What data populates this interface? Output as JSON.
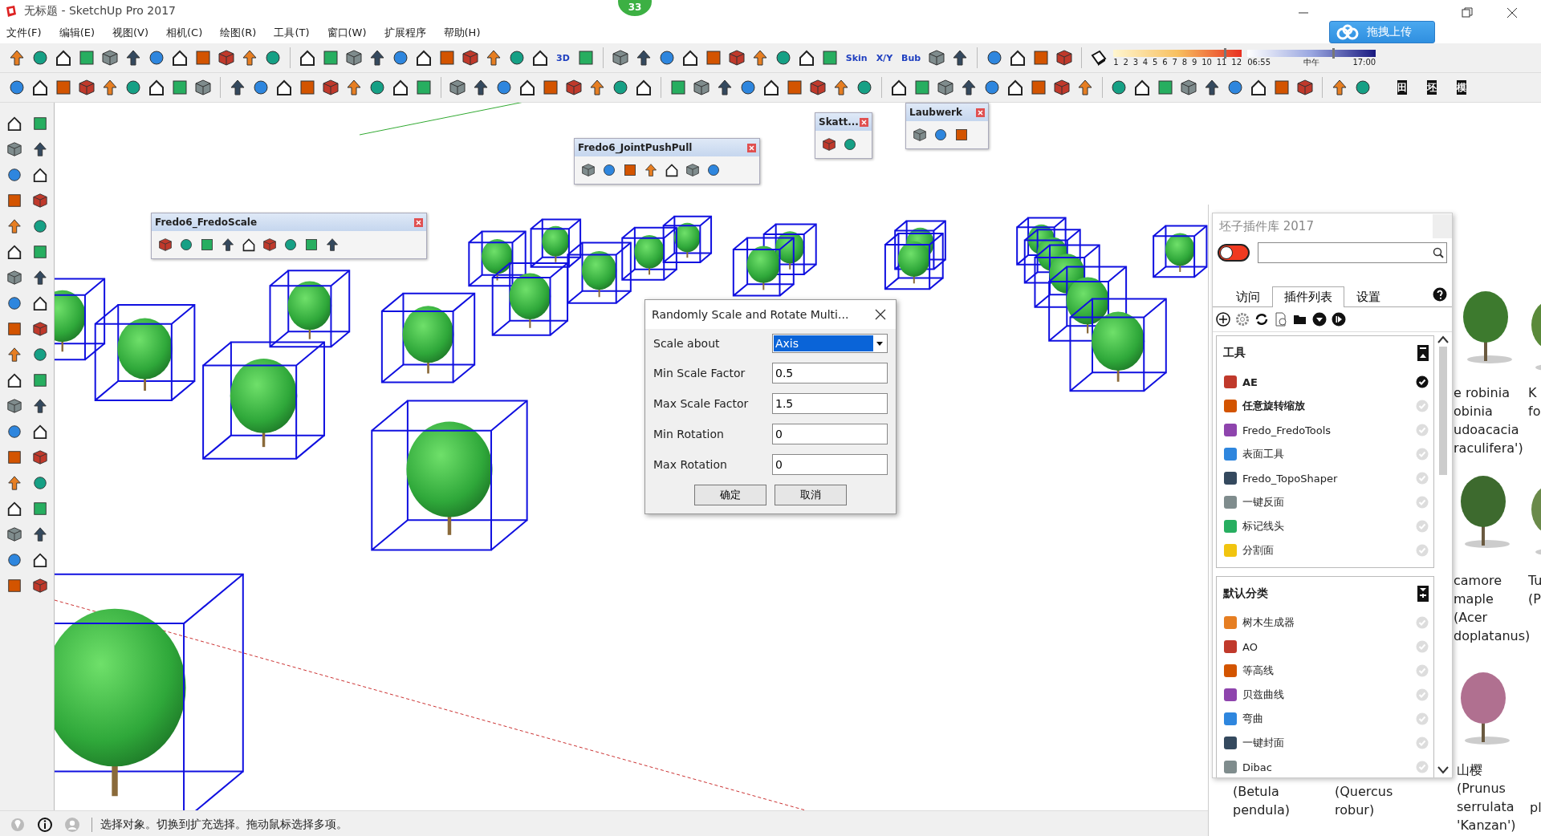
{
  "window": {
    "title": "无标题 - SketchUp Pro 2017"
  },
  "notification_badge": "33",
  "upload_button": "拖拽上传",
  "menu": [
    "文件(F)",
    "编辑(E)",
    "视图(V)",
    "相机(C)",
    "绘图(R)",
    "工具(T)",
    "窗口(W)",
    "扩展程序",
    "帮助(H)"
  ],
  "toolbar": {
    "icon_labels": [
      "3D",
      "Skin",
      "X/Y",
      "Bub"
    ],
    "shadow_date": {
      "labels": [
        "1",
        "2",
        "3",
        "4",
        "5",
        "6",
        "7",
        "8",
        "9",
        "10",
        "11",
        "12"
      ],
      "level": 0.86
    },
    "shadow_time": {
      "labels": [
        "06:55",
        "中午",
        "17:00"
      ],
      "level": 0.66
    },
    "view_buttons": [
      "田",
      "坯",
      "模"
    ]
  },
  "floating_toolbars": [
    {
      "title": "Fredo6_FredoScale"
    },
    {
      "title": "Fredo6_JointPushPull"
    },
    {
      "title": "Skatt..."
    },
    {
      "title": "Laubwerk"
    }
  ],
  "dialog": {
    "title": "Randomly Scale and Rotate Multi...",
    "fields": [
      {
        "kind": "select",
        "label": "Scale about",
        "value": "Axis"
      },
      {
        "kind": "text",
        "label": "Min Scale Factor",
        "value": "0.5"
      },
      {
        "kind": "text",
        "label": "Max Scale Factor",
        "value": "1.5"
      },
      {
        "kind": "text",
        "label": "Min Rotation",
        "value": "0"
      },
      {
        "kind": "text",
        "label": "Max Rotation",
        "value": "0"
      }
    ],
    "buttons": [
      "确定",
      "取消"
    ]
  },
  "plugin_panel": {
    "title": "坯子插件库 2017",
    "enabled": false,
    "tabs": [
      {
        "label": "访问",
        "selected": false
      },
      {
        "label": "插件列表",
        "selected": true
      },
      {
        "label": "设置",
        "selected": false
      }
    ],
    "sections": [
      {
        "title": "工具",
        "items": [
          {
            "name": "AE",
            "bold": true,
            "checked": true
          },
          {
            "name": "任意旋转缩放",
            "bold": true,
            "checked": false
          },
          {
            "name": "Fredo_FredoTools",
            "bold": false,
            "checked": false
          },
          {
            "name": "表面工具",
            "bold": false,
            "checked": false
          },
          {
            "name": "Fredo_TopoShaper",
            "bold": false,
            "checked": false
          },
          {
            "name": "一键反面",
            "bold": false,
            "checked": false
          },
          {
            "name": "标记线头",
            "bold": false,
            "checked": false
          },
          {
            "name": "分割面",
            "bold": false,
            "checked": false
          }
        ]
      },
      {
        "title": "默认分类",
        "items": [
          {
            "name": "树木生成器",
            "bold": false,
            "checked": false
          },
          {
            "name": "AO",
            "bold": false,
            "checked": false
          },
          {
            "name": "等高线",
            "bold": false,
            "checked": false
          },
          {
            "name": "贝兹曲线",
            "bold": false,
            "checked": false
          },
          {
            "name": "弯曲",
            "bold": false,
            "checked": false
          },
          {
            "name": "一键封面",
            "bold": false,
            "checked": false
          },
          {
            "name": "Dibac",
            "bold": false,
            "checked": false
          }
        ]
      }
    ]
  },
  "plant_browser": {
    "cards": [
      {
        "lines": [
          "e robinia",
          "obinia",
          "udoacacia",
          "raculifera')"
        ]
      },
      {
        "lines": [
          "K",
          "fo"
        ]
      },
      {
        "lines": [
          "camore",
          "maple",
          "(Acer",
          "doplatanus)"
        ]
      },
      {
        "lines": [
          "Tu",
          "(P"
        ]
      },
      {
        "lines": [
          "(Betula",
          "pendula)"
        ]
      },
      {
        "lines": [
          "(Quercus",
          "robur)"
        ]
      },
      {
        "lines": [
          "山樱",
          "(Prunus",
          "serrulata",
          "'Kanzan')"
        ]
      },
      {
        "lines": [
          "pl"
        ]
      }
    ]
  },
  "status_bar": {
    "text": "选择对象。切换到扩充选择。拖动鼠标选择多项。"
  }
}
